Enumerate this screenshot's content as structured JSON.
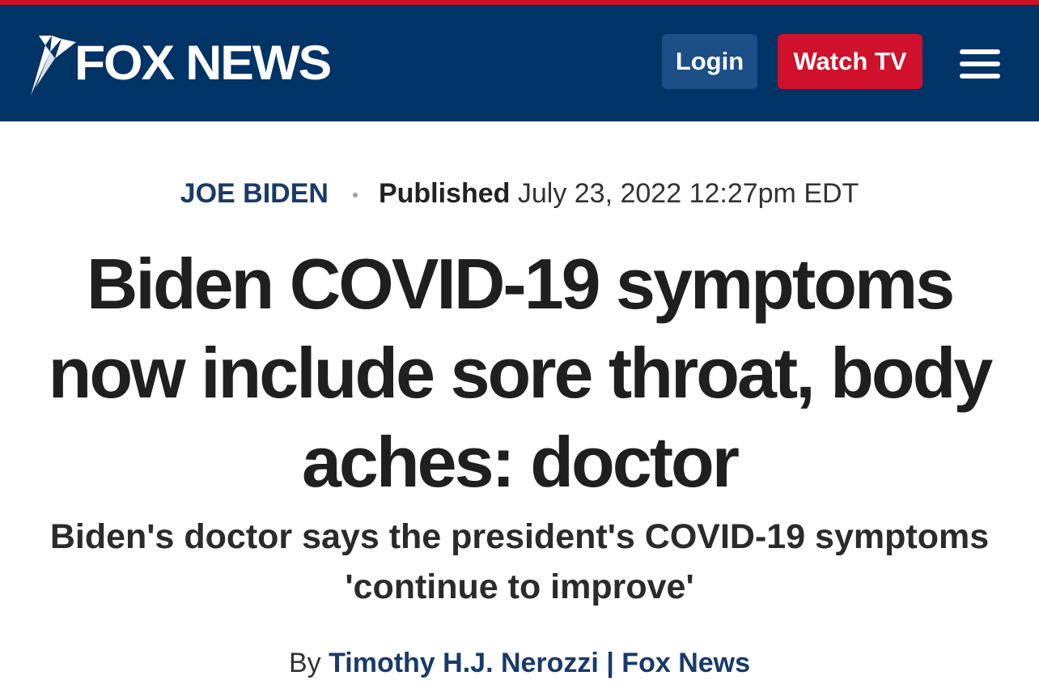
{
  "header": {
    "logo_text": "FOX NEWS",
    "login_label": "Login",
    "watch_label": "Watch TV",
    "menu_icon": "hamburger-menu-icon",
    "colors": {
      "header_bg": "#003366",
      "accent": "#cf1126",
      "login_bg": "#1b4f86",
      "watch_bg": "#d0112b"
    }
  },
  "article": {
    "category": "JOE BIDEN",
    "published_label": "Published",
    "published_date": "July 23, 2022 12:27pm EDT",
    "headline": "Biden COVID-19 symptoms now include sore throat, body aches: doctor",
    "subheadline": "Biden's doctor says the president's COVID-19 symptoms 'continue to improve'",
    "byline_prefix": "By",
    "author": "Timothy H.J. Nerozzi",
    "byline_separator": "|",
    "outlet": "Fox News"
  }
}
